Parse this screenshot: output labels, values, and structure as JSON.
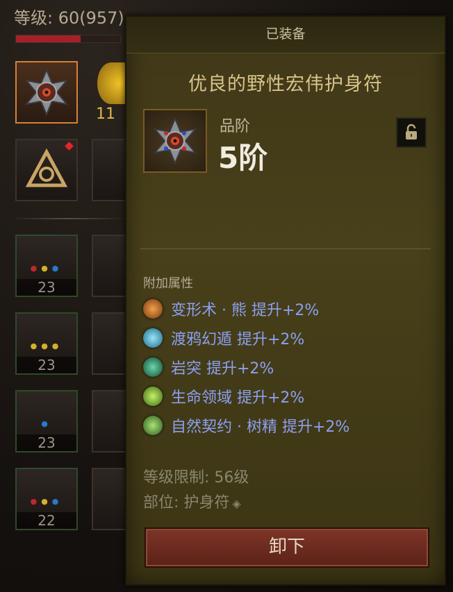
{
  "inventory": {
    "level_label": "等级: 60(957)",
    "gold_number": "11",
    "slot_levels": [
      "23",
      "23",
      "23",
      "22"
    ]
  },
  "tooltip": {
    "header": "已装备",
    "item_name": "优良的野性宏伟护身符",
    "tier_label": "品阶",
    "tier_value": "5阶",
    "affix_title": "附加属性",
    "affixes": [
      {
        "text": "变形术 · 熊  提升+2%",
        "icon": "bear-form-icon",
        "color": "#c56a1e"
      },
      {
        "text": "渡鸦幻遁  提升+2%",
        "icon": "raven-icon",
        "color": "#2ea7c8"
      },
      {
        "text": "岩突  提升+2%",
        "icon": "rock-spike-icon",
        "color": "#2d8f6e"
      },
      {
        "text": "生命领域  提升+2%",
        "icon": "life-field-icon",
        "color": "#7fbf2c"
      },
      {
        "text": "自然契约 · 树精  提升+2%",
        "icon": "nature-pact-icon",
        "color": "#5aa23a"
      }
    ],
    "level_req": "等级限制: 56级",
    "slot_info": "部位: 护身符",
    "unequip_label": "卸下"
  },
  "colors": {
    "tooltip_bg": "#443b18",
    "affix_text": "#8ca0f0",
    "unequip_button": "#6e2c20",
    "selected_slot_border": "#d6813a"
  }
}
